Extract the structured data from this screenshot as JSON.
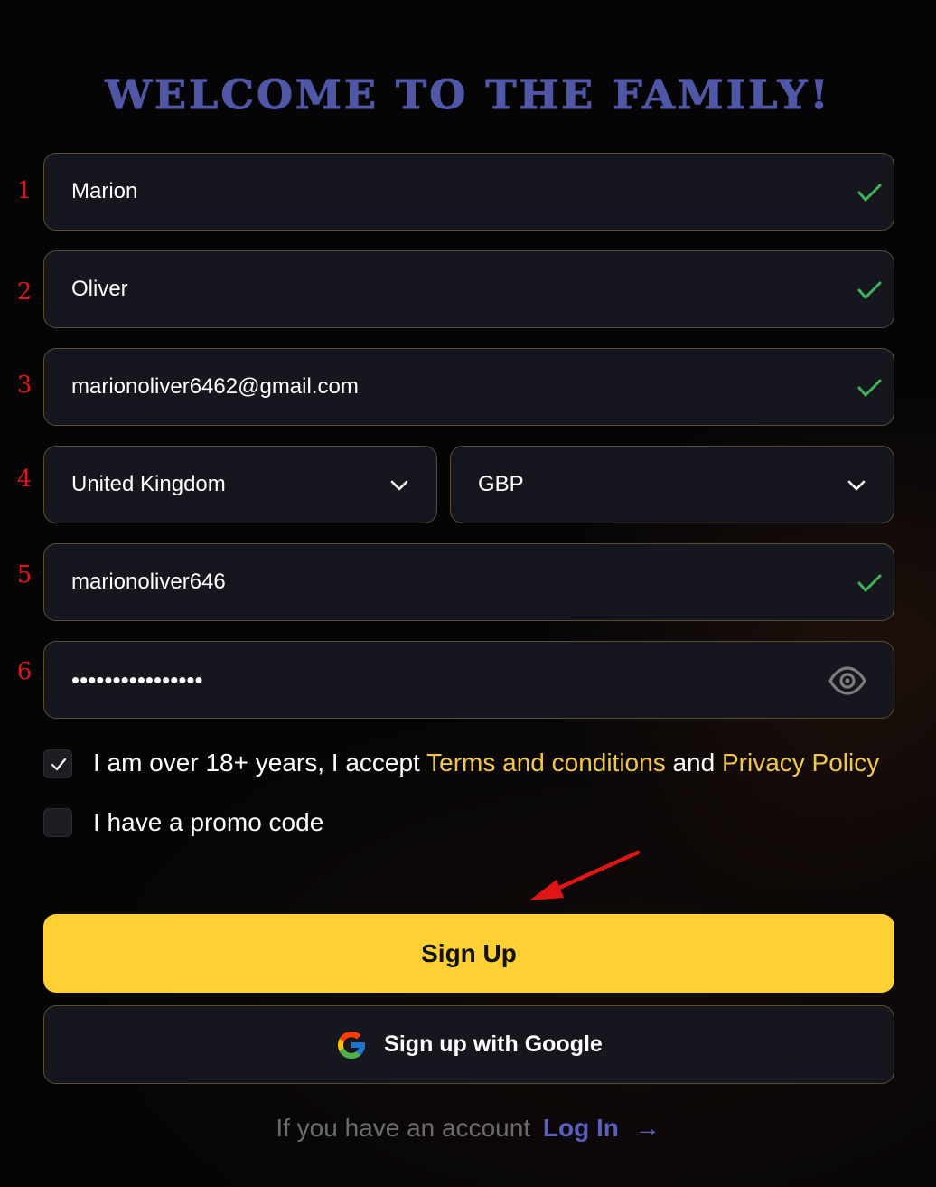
{
  "title": "WELCOME TO THE FAMILY!",
  "step_numbers": [
    "1",
    "2",
    "3",
    "4",
    "5",
    "6"
  ],
  "form": {
    "first_name": "Marion",
    "last_name": "Oliver",
    "email": "marionoliver6462@gmail.com",
    "country": "United Kingdom",
    "currency": "GBP",
    "username": "marionoliver646",
    "password_masked": "••••••••••••••••"
  },
  "terms": {
    "checked": true,
    "prefix": "I am over 18+ years, I accept",
    "terms_link": "Terms and conditions",
    "and": "and",
    "privacy_link": "Privacy Policy"
  },
  "promo": {
    "checked": false,
    "label": "I have a promo code"
  },
  "buttons": {
    "signup": "Sign Up",
    "google": "Sign up with Google"
  },
  "login": {
    "prompt": "If you have an account",
    "link": "Log In",
    "arrow": "→"
  },
  "colors": {
    "accent_yellow": "#ffd033",
    "link_yellow": "#f3c746",
    "title_blue": "#5057a6",
    "valid_green": "#3fb55a",
    "annotation_red": "#e01616"
  },
  "icons": {
    "valid": "check-icon",
    "dropdown": "chevron-down-icon",
    "password": "eye-icon",
    "google": "google-logo-icon",
    "annotation": "red-arrow-icon"
  }
}
